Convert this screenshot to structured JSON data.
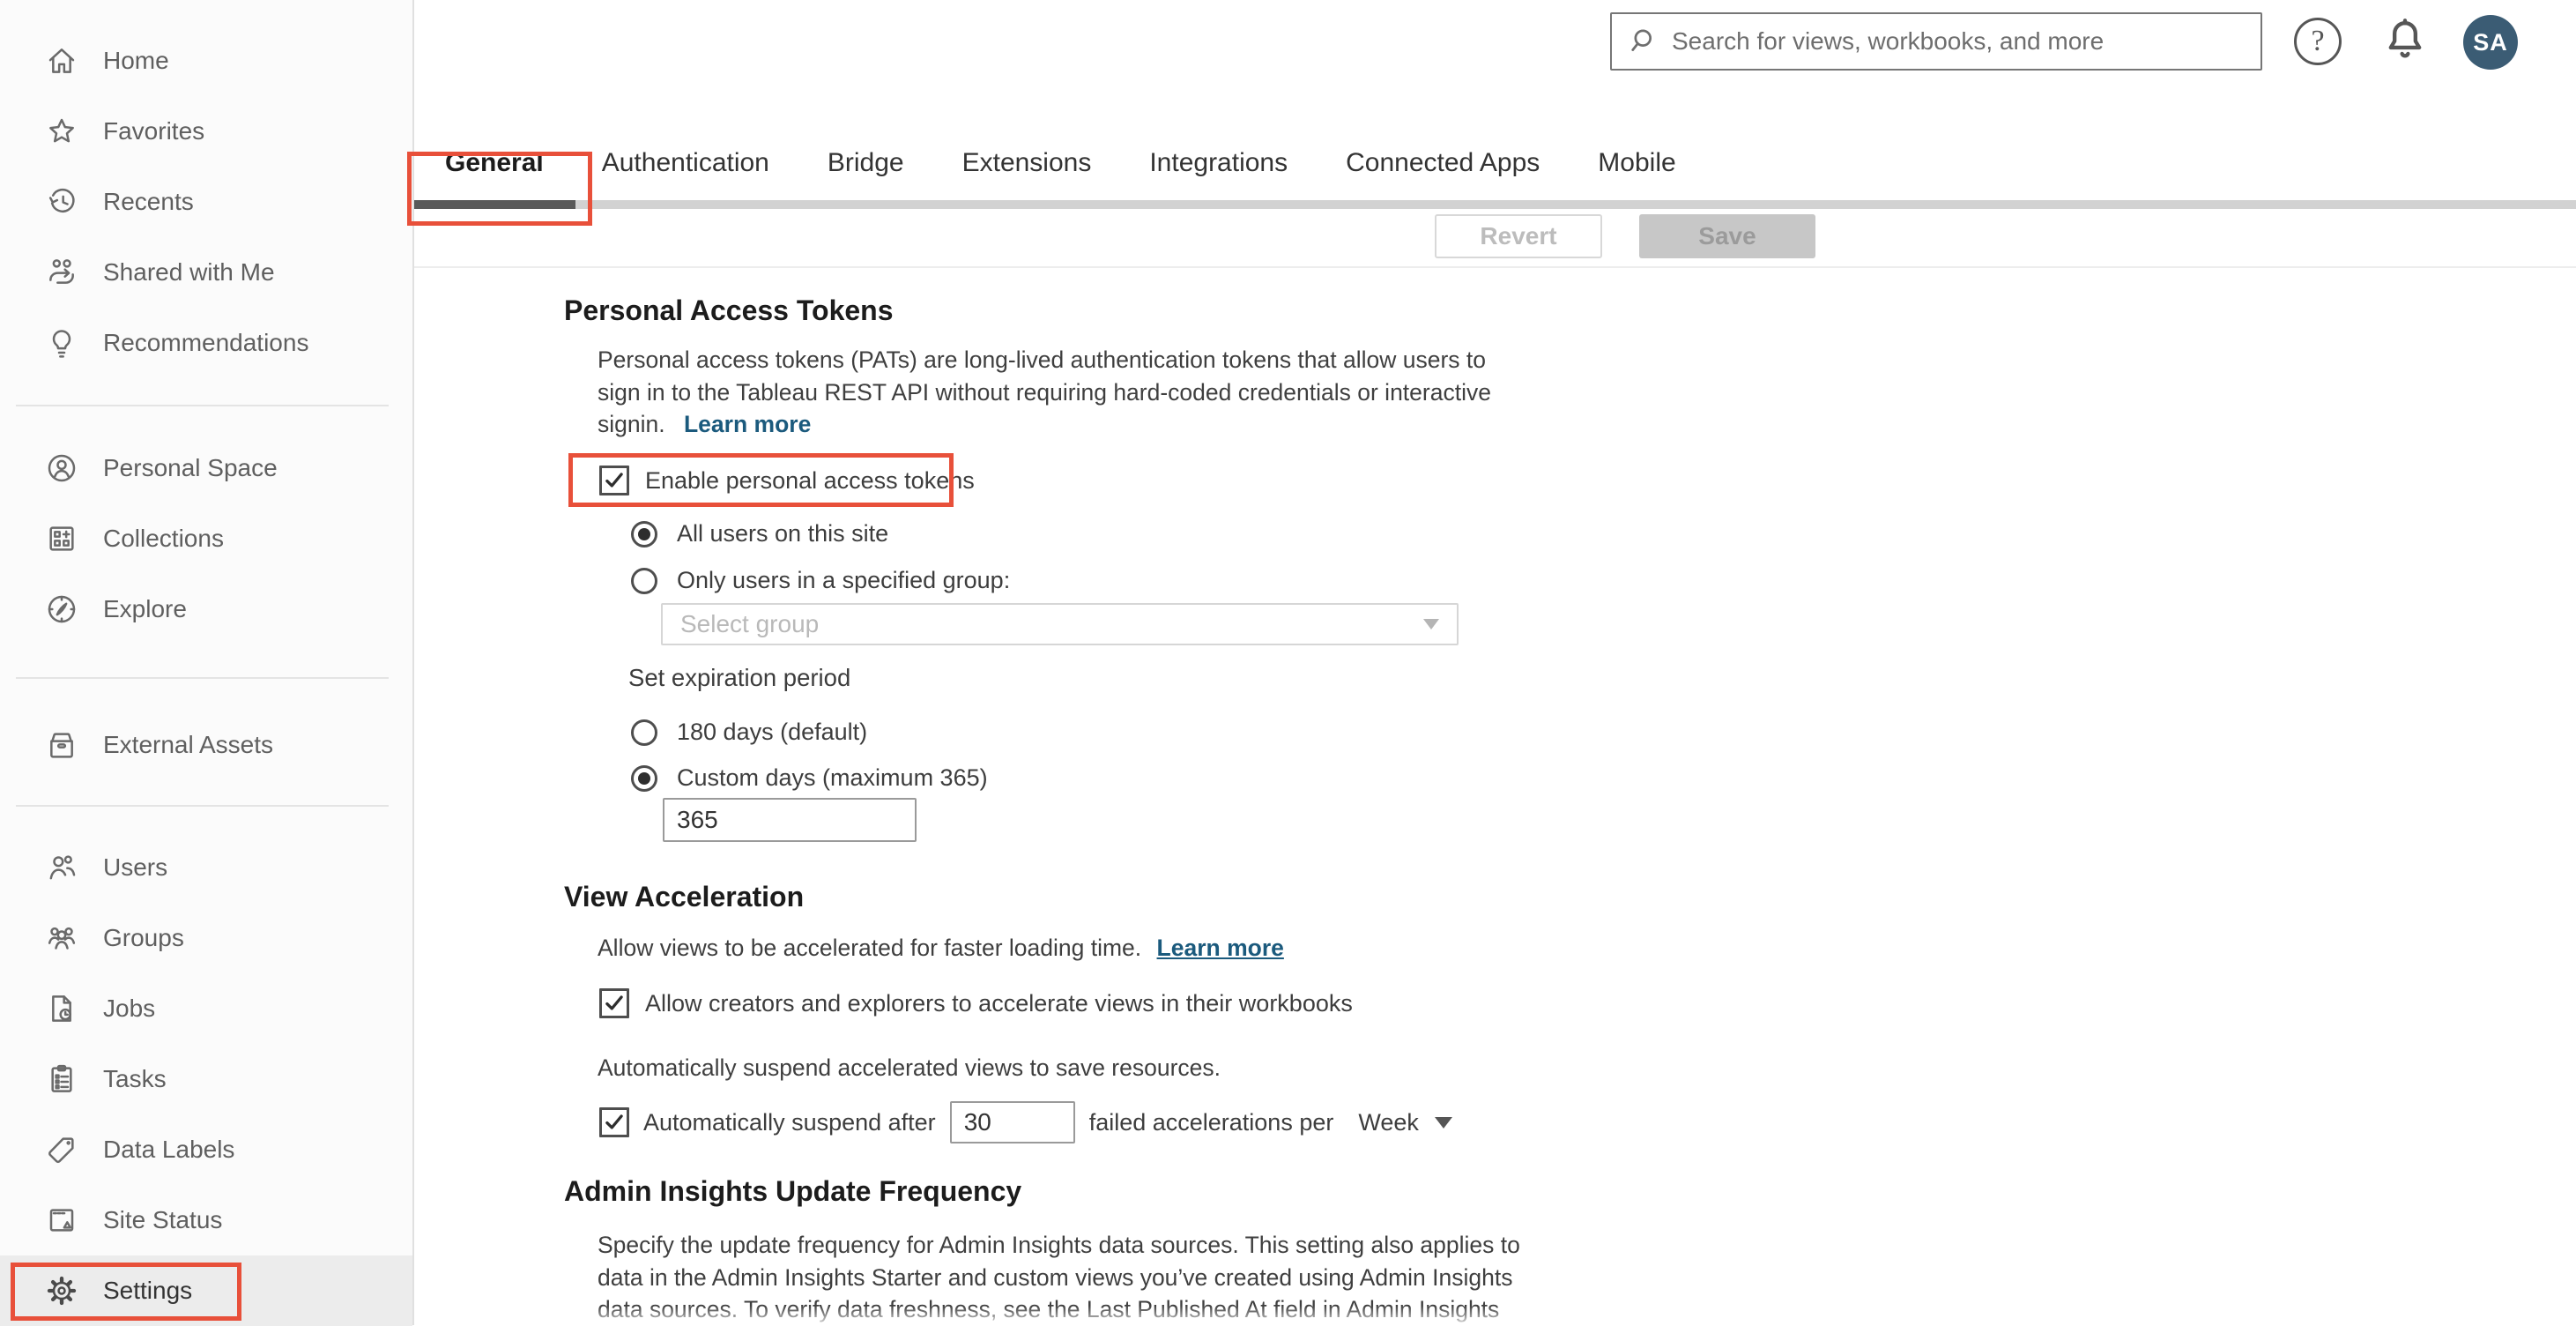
{
  "header": {
    "search": {
      "placeholder": "Search for views, workbooks, and more"
    },
    "avatar": {
      "initials": "SA"
    }
  },
  "sidebar": {
    "groups": [
      {
        "items": [
          {
            "label": "Home"
          },
          {
            "label": "Favorites"
          },
          {
            "label": "Recents"
          },
          {
            "label": "Shared with Me"
          },
          {
            "label": "Recommendations"
          }
        ]
      },
      {
        "items": [
          {
            "label": "Personal Space"
          },
          {
            "label": "Collections"
          },
          {
            "label": "Explore"
          }
        ]
      },
      {
        "items": [
          {
            "label": "External Assets"
          }
        ]
      },
      {
        "items": [
          {
            "label": "Users"
          },
          {
            "label": "Groups"
          },
          {
            "label": "Jobs"
          },
          {
            "label": "Tasks"
          },
          {
            "label": "Data Labels"
          },
          {
            "label": "Site Status"
          },
          {
            "label": "Settings"
          }
        ]
      }
    ]
  },
  "tabs": {
    "active": "General",
    "items": [
      {
        "label": "General"
      },
      {
        "label": "Authentication"
      },
      {
        "label": "Bridge"
      },
      {
        "label": "Extensions"
      },
      {
        "label": "Integrations"
      },
      {
        "label": "Connected Apps"
      },
      {
        "label": "Mobile"
      }
    ]
  },
  "toolbar": {
    "revert_label": "Revert",
    "save_label": "Save"
  },
  "pat": {
    "title": "Personal Access Tokens",
    "desc_line1": "Personal access tokens (PATs) are long-lived authentication tokens that allow users to",
    "desc_line2": "sign in to the Tableau REST API without requiring hard-coded credentials or interactive",
    "desc_line3": "signin.",
    "learn_more": "Learn more",
    "enable_label": "Enable personal access tokens",
    "all_users_label": "All users on this site",
    "group_label": "Only users in a specified group:",
    "group_placeholder": "Select group",
    "expiration_title": "Set expiration period",
    "days_default_label": "180 days (default)",
    "days_custom_label": "Custom days (maximum 365)",
    "custom_days_value": "365"
  },
  "view_acceleration": {
    "title": "View Acceleration",
    "description": "Allow views to be accelerated for faster loading time.",
    "learn_more": "Learn more",
    "allow_label": "Allow creators and explorers to accelerate views in their workbooks",
    "suspend_note": "Automatically suspend accelerated views to save resources.",
    "suspend_prefix": "Automatically suspend after",
    "suspend_count": "30",
    "suspend_suffix": "failed accelerations per",
    "suspend_period": "Week"
  },
  "admin_insights": {
    "title": "Admin Insights Update Frequency",
    "desc_line1": "Specify the update frequency for Admin Insights data sources. This setting also applies to",
    "desc_line2": "data in the Admin Insights Starter and custom views you’ve created using Admin Insights",
    "desc_line3": "data sources. To verify data freshness, see the Last Published At field in Admin Insights"
  },
  "colors": {
    "annotation_red": "#e8503a",
    "link_blue": "#1b5a7d",
    "avatar_bg": "#3b5c74",
    "active_tab_underline": "#595959",
    "tab_track": "#d2d2d2",
    "selected_row_bg": "#ececec"
  }
}
